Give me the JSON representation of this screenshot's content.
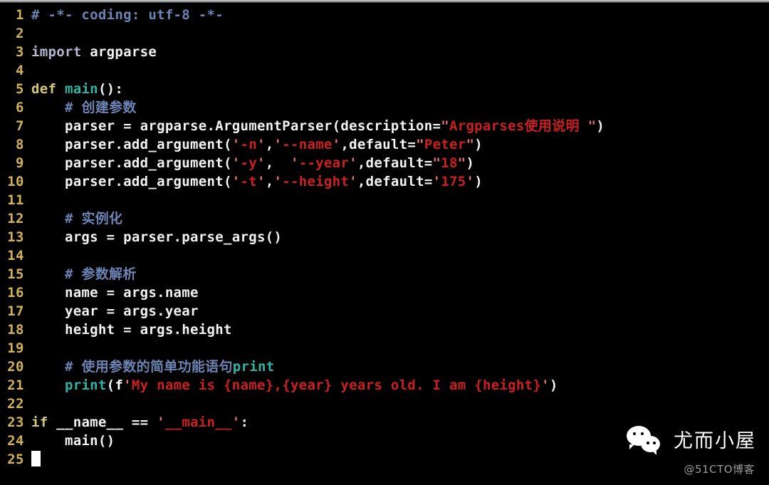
{
  "editor": {
    "theme": "dark",
    "language": "python",
    "background_color": "#000000",
    "line_number_color": "#d2b257",
    "comment_color": "#6b84b4",
    "keyword_color": "#d4c87a",
    "import_color": "#b9b6d4",
    "function_color": "#2fb3a5",
    "string_color": "#cc1f1f",
    "text_color": "#f2f2f2",
    "lines": [
      {
        "number": "1",
        "tokens": [
          {
            "t": "# -*- coding: utf-8 -*-",
            "c": "comment"
          }
        ]
      },
      {
        "number": "2",
        "tokens": []
      },
      {
        "number": "3",
        "tokens": [
          {
            "t": "import",
            "c": "import"
          },
          {
            "t": " ",
            "c": "plain"
          },
          {
            "t": "argparse",
            "c": "plain"
          }
        ]
      },
      {
        "number": "4",
        "tokens": []
      },
      {
        "number": "5",
        "tokens": [
          {
            "t": "def",
            "c": "keyword"
          },
          {
            "t": " ",
            "c": "plain"
          },
          {
            "t": "main",
            "c": "func"
          },
          {
            "t": "():",
            "c": "plain"
          }
        ]
      },
      {
        "number": "6",
        "tokens": [
          {
            "t": "    ",
            "c": "plain"
          },
          {
            "t": "# 创建参数",
            "c": "comment"
          }
        ]
      },
      {
        "number": "7",
        "tokens": [
          {
            "t": "    parser = argparse.ArgumentParser(description=",
            "c": "plain"
          },
          {
            "t": "\"",
            "c": "quote"
          },
          {
            "t": "Argparses使用说明 ",
            "c": "string"
          },
          {
            "t": "\"",
            "c": "quote"
          },
          {
            "t": ")",
            "c": "plain"
          }
        ]
      },
      {
        "number": "8",
        "tokens": [
          {
            "t": "    parser.add_argument(",
            "c": "plain"
          },
          {
            "t": "'",
            "c": "quote"
          },
          {
            "t": "-n",
            "c": "string"
          },
          {
            "t": "'",
            "c": "quote"
          },
          {
            "t": ",",
            "c": "plain"
          },
          {
            "t": "'",
            "c": "quote"
          },
          {
            "t": "--name",
            "c": "string"
          },
          {
            "t": "'",
            "c": "quote"
          },
          {
            "t": ",default=",
            "c": "plain"
          },
          {
            "t": "\"",
            "c": "quote"
          },
          {
            "t": "Peter",
            "c": "string"
          },
          {
            "t": "\"",
            "c": "quote"
          },
          {
            "t": ")",
            "c": "plain"
          }
        ]
      },
      {
        "number": "9",
        "tokens": [
          {
            "t": "    parser.add_argument(",
            "c": "plain"
          },
          {
            "t": "'",
            "c": "quote"
          },
          {
            "t": "-y",
            "c": "string"
          },
          {
            "t": "'",
            "c": "quote"
          },
          {
            "t": ",  ",
            "c": "plain"
          },
          {
            "t": "'",
            "c": "quote"
          },
          {
            "t": "--year",
            "c": "string"
          },
          {
            "t": "'",
            "c": "quote"
          },
          {
            "t": ",default=",
            "c": "plain"
          },
          {
            "t": "\"",
            "c": "quote"
          },
          {
            "t": "18",
            "c": "string"
          },
          {
            "t": "\"",
            "c": "quote"
          },
          {
            "t": ")",
            "c": "plain"
          }
        ]
      },
      {
        "number": "10",
        "tokens": [
          {
            "t": "    parser.add_argument(",
            "c": "plain"
          },
          {
            "t": "'",
            "c": "quote"
          },
          {
            "t": "-t",
            "c": "string"
          },
          {
            "t": "'",
            "c": "quote"
          },
          {
            "t": ",",
            "c": "plain"
          },
          {
            "t": "'",
            "c": "quote"
          },
          {
            "t": "--height",
            "c": "string"
          },
          {
            "t": "'",
            "c": "quote"
          },
          {
            "t": ",default=",
            "c": "plain"
          },
          {
            "t": "'",
            "c": "quote"
          },
          {
            "t": "175",
            "c": "string"
          },
          {
            "t": "'",
            "c": "quote"
          },
          {
            "t": ")",
            "c": "plain"
          }
        ]
      },
      {
        "number": "11",
        "tokens": []
      },
      {
        "number": "12",
        "tokens": [
          {
            "t": "    ",
            "c": "plain"
          },
          {
            "t": "# 实例化",
            "c": "comment"
          }
        ]
      },
      {
        "number": "13",
        "tokens": [
          {
            "t": "    args = parser.parse_args()",
            "c": "plain"
          }
        ]
      },
      {
        "number": "14",
        "tokens": []
      },
      {
        "number": "15",
        "tokens": [
          {
            "t": "    ",
            "c": "plain"
          },
          {
            "t": "# 参数解析",
            "c": "comment"
          }
        ]
      },
      {
        "number": "16",
        "tokens": [
          {
            "t": "    name = args.name",
            "c": "plain"
          }
        ]
      },
      {
        "number": "17",
        "tokens": [
          {
            "t": "    year = args.year",
            "c": "plain"
          }
        ]
      },
      {
        "number": "18",
        "tokens": [
          {
            "t": "    height = args.height",
            "c": "plain"
          }
        ]
      },
      {
        "number": "19",
        "tokens": []
      },
      {
        "number": "20",
        "tokens": [
          {
            "t": "    ",
            "c": "plain"
          },
          {
            "t": "# 使用参数的简单功能语句",
            "c": "comment"
          },
          {
            "t": "print",
            "c": "func"
          }
        ]
      },
      {
        "number": "21",
        "tokens": [
          {
            "t": "    ",
            "c": "plain"
          },
          {
            "t": "print",
            "c": "func"
          },
          {
            "t": "(",
            "c": "plain"
          },
          {
            "t": "f",
            "c": "fprefix"
          },
          {
            "t": "'",
            "c": "quote"
          },
          {
            "t": "My name is {name},{year} years old. I am {height}",
            "c": "string"
          },
          {
            "t": "'",
            "c": "quote"
          },
          {
            "t": ")",
            "c": "plain"
          }
        ]
      },
      {
        "number": "22",
        "tokens": []
      },
      {
        "number": "23",
        "tokens": [
          {
            "t": "if",
            "c": "keyword"
          },
          {
            "t": " __name__ == ",
            "c": "plain"
          },
          {
            "t": "'",
            "c": "quote"
          },
          {
            "t": "__main__",
            "c": "string"
          },
          {
            "t": "'",
            "c": "quote"
          },
          {
            "t": ":",
            "c": "plain"
          }
        ]
      },
      {
        "number": "24",
        "tokens": [
          {
            "t": "    main()",
            "c": "plain"
          }
        ]
      },
      {
        "number": "25",
        "tokens": [],
        "cursor": true
      }
    ]
  },
  "watermark": {
    "logo_icon": "wechat-logo-icon",
    "title": "尤而小屋",
    "subtitle": "@51CTO博客",
    "title_color": "#ffffff",
    "subtitle_color": "#9b9b9b"
  }
}
